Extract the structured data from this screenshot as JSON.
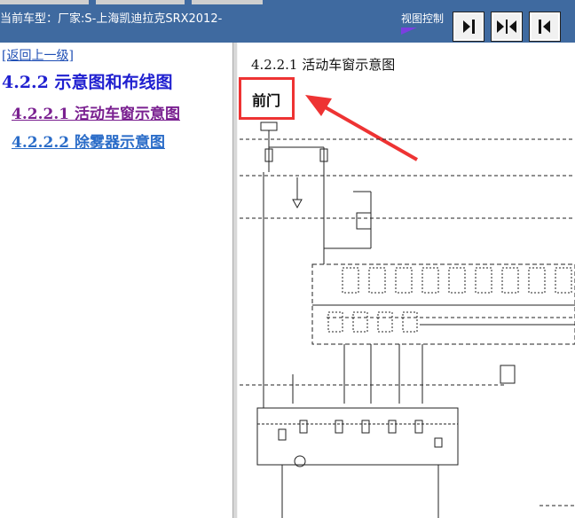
{
  "header": {
    "model_label": "当前车型：厂家:S-上海凯迪拉克SRX2012-",
    "view_control": "视图控制",
    "buttons": [
      {
        "name": "next-page-button",
        "icon": "arrow-right-bar-icon"
      },
      {
        "name": "fit-width-button",
        "icon": "arrows-inward-icon"
      },
      {
        "name": "previous-page-button",
        "icon": "arrow-left-bar-icon"
      }
    ]
  },
  "sidebar": {
    "back_link": "[返回上一级]",
    "section_title": "4.2.2 示意图和布线图",
    "items": [
      {
        "label": "4.2.2.1 活动车窗示意图",
        "visited": true
      },
      {
        "label": "4.2.2.2 除雾器示意图",
        "visited": false
      }
    ]
  },
  "content": {
    "diagram_title": "4.2.2.1 活动车窗示意图",
    "annotation": "前门",
    "colors": {
      "highlight": "#ee3333",
      "header_bg": "#3f6aa0",
      "link": "#2020d0",
      "visited": "#7a2090"
    }
  }
}
